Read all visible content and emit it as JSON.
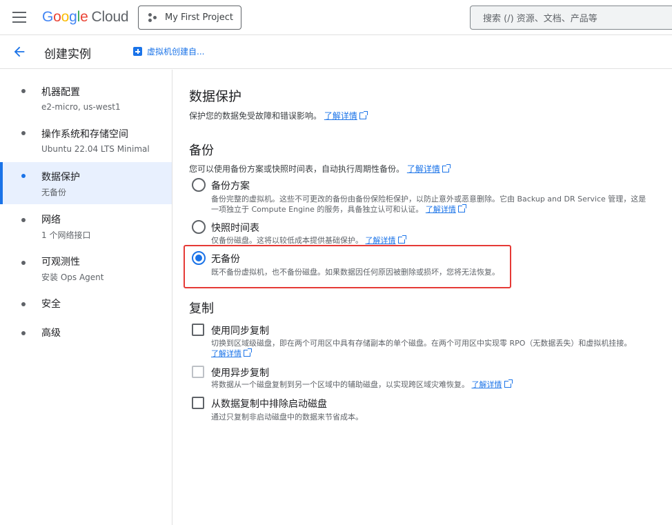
{
  "topbar": {
    "logo_parts": [
      "G",
      "o",
      "o",
      "g",
      "l",
      "e"
    ],
    "logo_product": "Cloud",
    "project_name": "My First Project",
    "search_placeholder": "搜索 (/) 资源、文档、产品等"
  },
  "subheader": {
    "title": "创建实例",
    "vm_link": "虚拟机创建自..."
  },
  "sidebar": {
    "items": [
      {
        "label": "机器配置",
        "sub": "e2-micro, us-west1"
      },
      {
        "label": "操作系统和存储空间",
        "sub": "Ubuntu 22.04 LTS Minimal"
      },
      {
        "label": "数据保护",
        "sub": "无备份",
        "active": true
      },
      {
        "label": "网络",
        "sub": "1 个网络接口"
      },
      {
        "label": "可观测性",
        "sub": "安装 Ops Agent"
      },
      {
        "label": "安全",
        "sub": ""
      },
      {
        "label": "高级",
        "sub": ""
      }
    ]
  },
  "main": {
    "title": "数据保护",
    "desc": "保护您的数据免受故障和错误影响。",
    "learn_more": "了解详情",
    "backup": {
      "heading": "备份",
      "desc": "您可以使用备份方案或快照时间表，自动执行周期性备份。",
      "options": [
        {
          "label": "备份方案",
          "desc_line1": "备份完整的虚拟机。这些不可更改的备份由备份保险柜保护，以防止意外或恶意删除。它由 Backup and DR Service 管理，这是",
          "desc_line2": "一项独立于 Compute Engine 的服务，具备独立认可和认证。",
          "checked": false
        },
        {
          "label": "快照时间表",
          "desc_line1": "仅备份磁盘。这将以较低成本提供基础保护。",
          "checked": false
        },
        {
          "label": "无备份",
          "desc_line1": "既不备份虚拟机，也不备份磁盘。如果数据因任何原因被删除或损坏，您将无法恢复。",
          "checked": true
        }
      ]
    },
    "replication": {
      "heading": "复制",
      "options": [
        {
          "label": "使用同步复制",
          "desc_line1": "切换到区域级磁盘，即在两个可用区中具有存储副本的单个磁盘。在两个可用区中实现零 RPO（无数据丢失）和虚拟机挂接。",
          "checked": false
        },
        {
          "label": "使用异步复制",
          "desc_line1": "将数据从一个磁盘复制到另一个区域中的辅助磁盘，以实现跨区域灾难恢复。",
          "checked": false,
          "disabled": true
        },
        {
          "label": "从数据复制中排除启动磁盘",
          "desc_line1": "通过只复制非启动磁盘中的数据来节省成本。",
          "checked": false
        }
      ]
    }
  },
  "colors": {
    "accent": "#1a73e8",
    "highlight": "#e53935",
    "active_bg": "#e8f0fe"
  }
}
